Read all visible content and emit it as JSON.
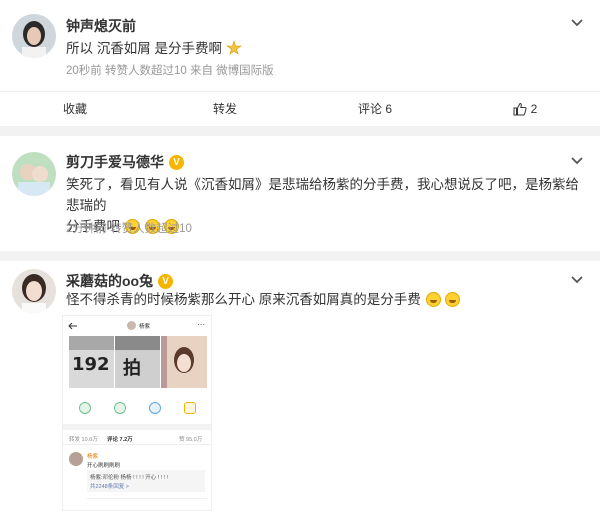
{
  "post1": {
    "username": "钟声熄灭前",
    "text": "所以 沉香如屑 是分手费啊",
    "meta": "20秒前  转赞人数超过10  来自 微博国际版",
    "actions": {
      "fav": "收藏",
      "repost": "转发",
      "comment": "评论 6",
      "like": "2"
    }
  },
  "post2": {
    "username": "剪刀手爱马德华",
    "text_line1": "笑死了，看见有人说《沉香如屑》是悲瑞给杨紫的分手费，我心想说反了吧，是杨紫给悲瑞的",
    "text_line2": "分手费吧",
    "meta": "2分钟前  转赞人数超过10"
  },
  "post3": {
    "username": "采蘑菇的oo兔",
    "text": "怪不得杀青的时候杨紫那么开心 原来沉香如屑真的是分手费",
    "embedded": {
      "header_name": "杨紫",
      "thumb_text_1": "192",
      "thumb_text_2": "拍",
      "tab_repost": "转发 10.0万",
      "tab_comment": "评论 7.2万",
      "tab_like": "赞 95.0万",
      "comment_user": "杨紫",
      "comment_text": "开心刷刷刷刷",
      "reply_text": "杨紫:邓伦粉 杨杨 ! ! ! ! 开心 ! ! ! !",
      "reply_more": "共2248条回复 >"
    }
  },
  "colors": {
    "accent": "#f7b500",
    "gap": "#f2f2f2",
    "meta": "#999999"
  },
  "icons": [
    "chevron-down-icon",
    "thumbs-up-icon",
    "verified-badge-icon",
    "emoji-laugh-icon"
  ]
}
